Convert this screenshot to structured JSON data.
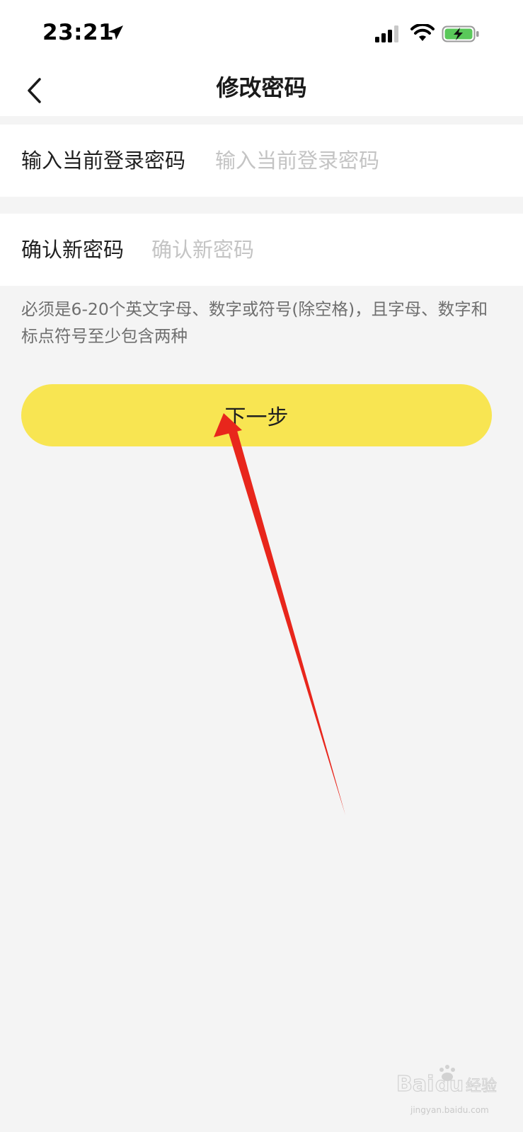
{
  "status_bar": {
    "time": "23:21",
    "icons": [
      "location-arrow-icon",
      "cellular-signal-icon",
      "wifi-icon",
      "battery-charging-icon"
    ],
    "battery_color": "#5ac85a"
  },
  "header": {
    "title": "修改密码",
    "back_icon": "chevron-left-icon"
  },
  "form": {
    "current_password": {
      "label": "输入当前登录密码",
      "placeholder": "输入当前登录密码",
      "value": ""
    },
    "new_password": {
      "label": "确认新密码",
      "placeholder": "确认新密码",
      "value": ""
    },
    "hint": "必须是6-20个英文字母、数字或符号(除空格)，且字母、数字和标点符号至少包含两种"
  },
  "actions": {
    "next_label": "下一步"
  },
  "colors": {
    "accent": "#f8e552",
    "annotation_arrow": "#e8261c",
    "background": "#f4f4f4"
  },
  "watermark": {
    "logo_text": "Baidu经验",
    "url": "jingyan.baidu.com"
  }
}
